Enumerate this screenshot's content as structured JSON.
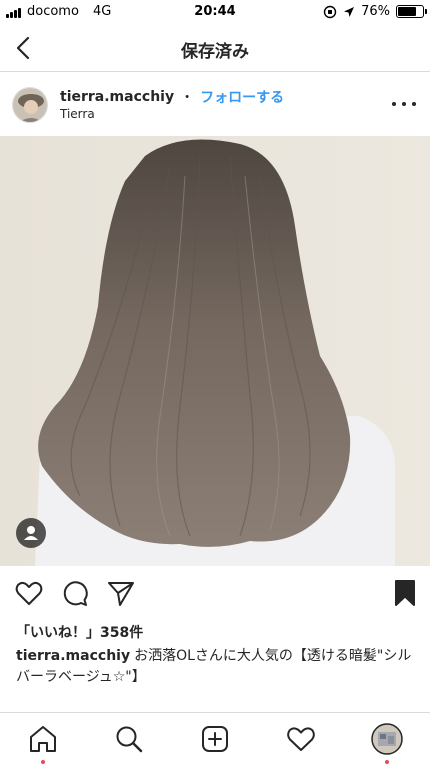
{
  "status_bar": {
    "carrier": "docomo",
    "network": "4G",
    "time": "20:44",
    "battery_text": "76%",
    "battery_level": 0.76
  },
  "nav": {
    "title": "保存済み",
    "back_icon": "chevron-left-icon"
  },
  "post": {
    "username": "tierra.macchiy",
    "separator": "・",
    "follow_label": "フォローする",
    "location": "Tierra",
    "more_icon": "ellipsis-icon"
  },
  "photo": {
    "tag_icon": "user-tag-icon"
  },
  "actions": {
    "like_icon": "heart-icon",
    "comment_icon": "comment-icon",
    "share_icon": "send-icon",
    "save_icon": "bookmark-filled-icon"
  },
  "likes_text": "「いいね！」358件",
  "caption": {
    "username": "tierra.macchiy",
    "text": "お洒落OLさんに大人気の【透ける暗髪\"シルバーラベージュ☆\"】"
  },
  "tabbar": {
    "home_icon": "home-icon",
    "search_icon": "search-icon",
    "add_icon": "add-post-icon",
    "activity_icon": "heart-icon",
    "profile_icon": "profile-avatar"
  },
  "colors": {
    "link_blue": "#3897f0",
    "notification_red": "#ed4956",
    "divider": "#dbdbdb",
    "text": "#262626"
  }
}
